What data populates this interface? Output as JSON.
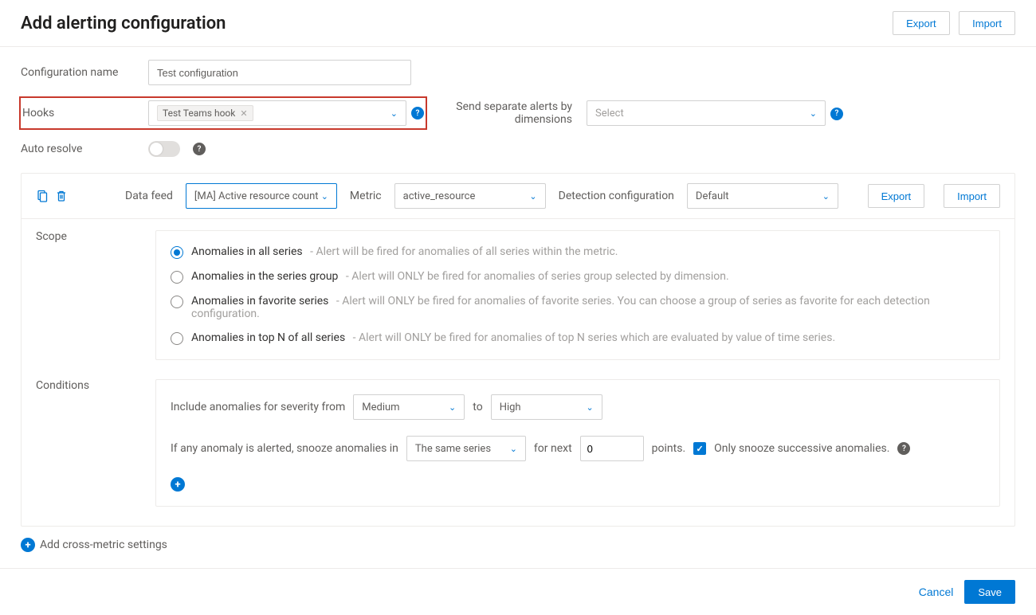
{
  "header": {
    "title": "Add alerting configuration",
    "export": "Export",
    "import": "Import"
  },
  "form": {
    "config_label": "Configuration name",
    "config_value": "Test configuration",
    "hooks_label": "Hooks",
    "hooks_chip": "Test Teams hook",
    "separate_label": "Send separate alerts by dimensions",
    "separate_placeholder": "Select",
    "autoresolve_label": "Auto resolve"
  },
  "metric_row": {
    "datafeed_label": "Data feed",
    "datafeed_value": "[MA] Active resource count",
    "metric_label": "Metric",
    "metric_value": "active_resource",
    "detect_label": "Detection configuration",
    "detect_value": "Default",
    "export": "Export",
    "import": "Import"
  },
  "scope": {
    "title": "Scope",
    "options": [
      {
        "label": "Anomalies in all series",
        "desc": "- Alert will be fired for anomalies of all series within the metric.",
        "checked": true
      },
      {
        "label": "Anomalies in the series group",
        "desc": "- Alert will ONLY be fired for anomalies of series group selected by dimension.",
        "checked": false
      },
      {
        "label": "Anomalies in favorite series",
        "desc": "- Alert will ONLY be fired for anomalies of favorite series. You can choose a group of series as favorite for each detection configuration.",
        "checked": false
      },
      {
        "label": "Anomalies in top N of all series",
        "desc": "- Alert will ONLY be fired for anomalies of top N series which are evaluated by value of time series.",
        "checked": false
      }
    ]
  },
  "conditions": {
    "title": "Conditions",
    "sev_prefix": "Include anomalies for severity from",
    "sev_from": "Medium",
    "sev_to_word": "to",
    "sev_to": "High",
    "snooze_prefix": "If any anomaly is alerted, snooze anomalies in",
    "snooze_scope": "The same series",
    "snooze_for": "for next",
    "snooze_value": "0",
    "snooze_points": "points.",
    "snooze_chk": "Only snooze successive anomalies."
  },
  "cross_metric": "Add cross-metric settings",
  "footer": {
    "cancel": "Cancel",
    "save": "Save"
  }
}
